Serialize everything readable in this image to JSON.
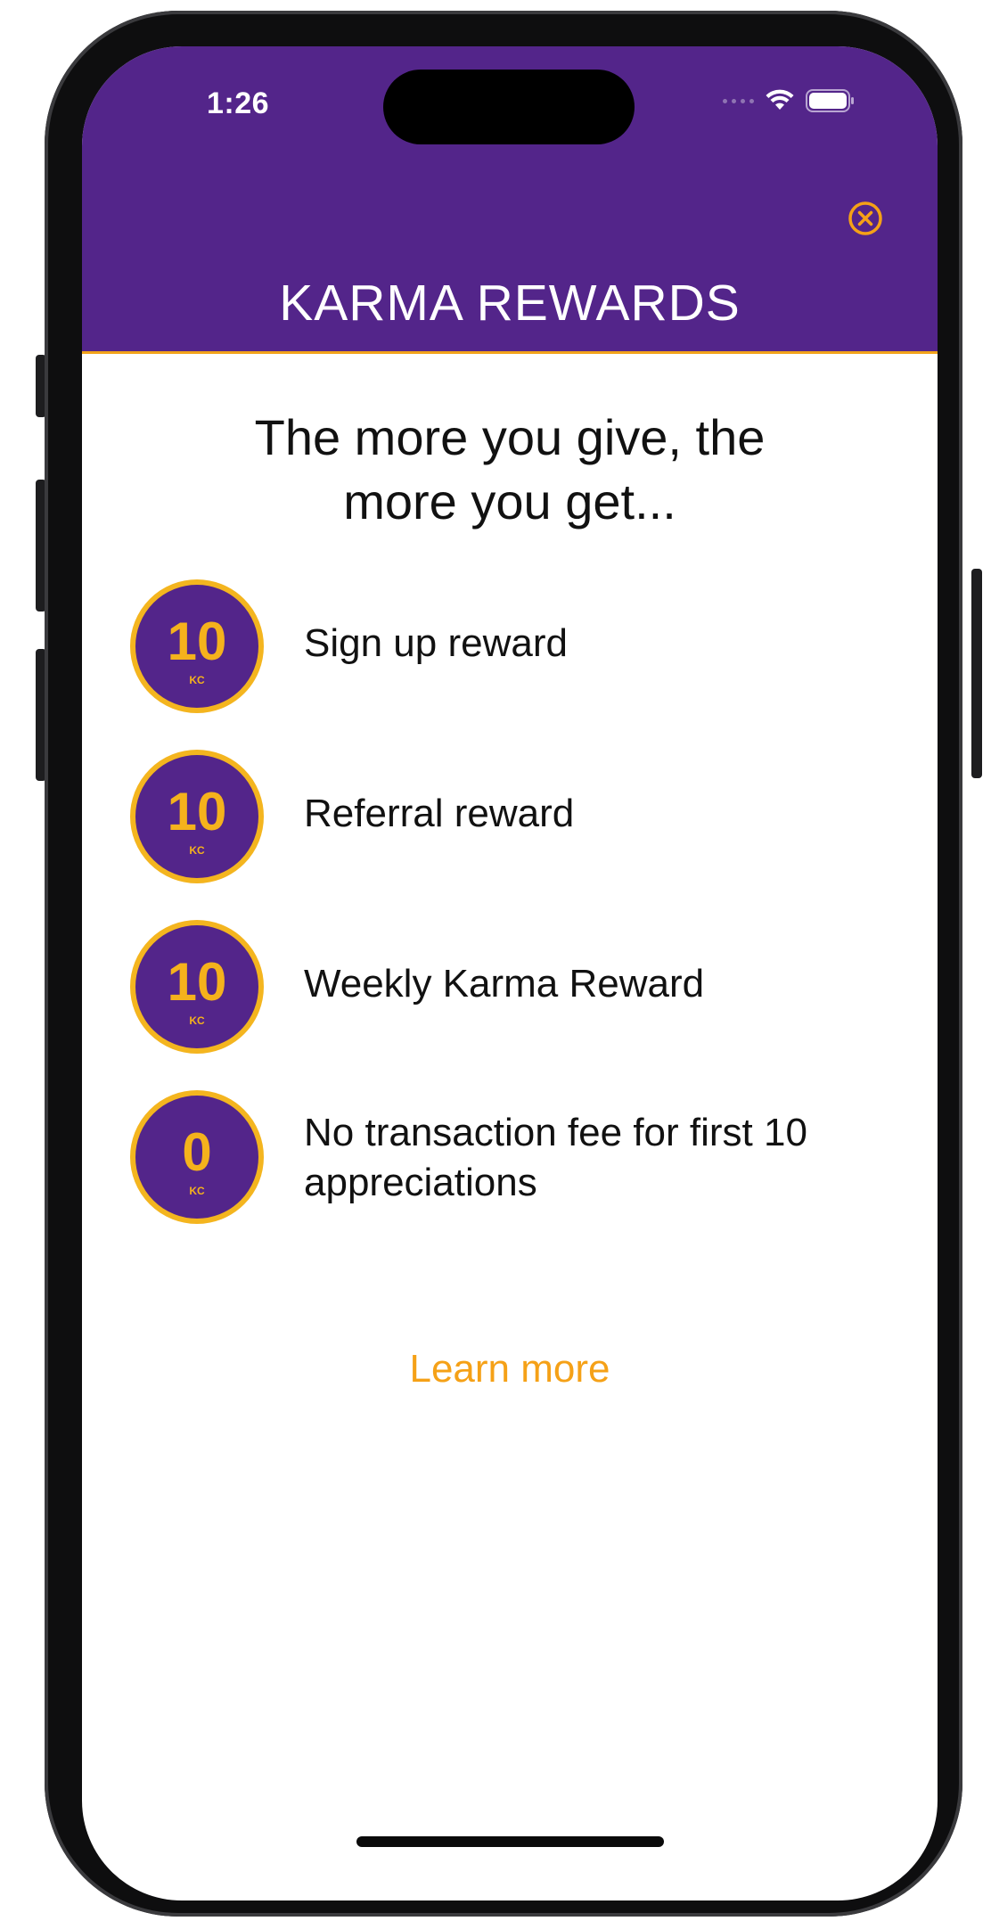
{
  "status_bar": {
    "time": "1:26"
  },
  "header": {
    "title": "KARMA REWARDS",
    "close_icon": "close-circle-icon",
    "background_color": "#53258a",
    "accent_color": "#f2a31a"
  },
  "tagline": {
    "line1": "The more you give, the",
    "line2": "more you get..."
  },
  "rewards": [
    {
      "value": "10",
      "unit": "KC",
      "label": "Sign up reward"
    },
    {
      "value": "10",
      "unit": "KC",
      "label": "Referral reward"
    },
    {
      "value": "10",
      "unit": "KC",
      "label": "Weekly Karma Reward"
    },
    {
      "value": "0",
      "unit": "KC",
      "label_line1": "No transaction fee for first 10",
      "label_line2": "appreciations"
    }
  ],
  "learn_more": {
    "label": "Learn more",
    "color": "#f5a117"
  }
}
